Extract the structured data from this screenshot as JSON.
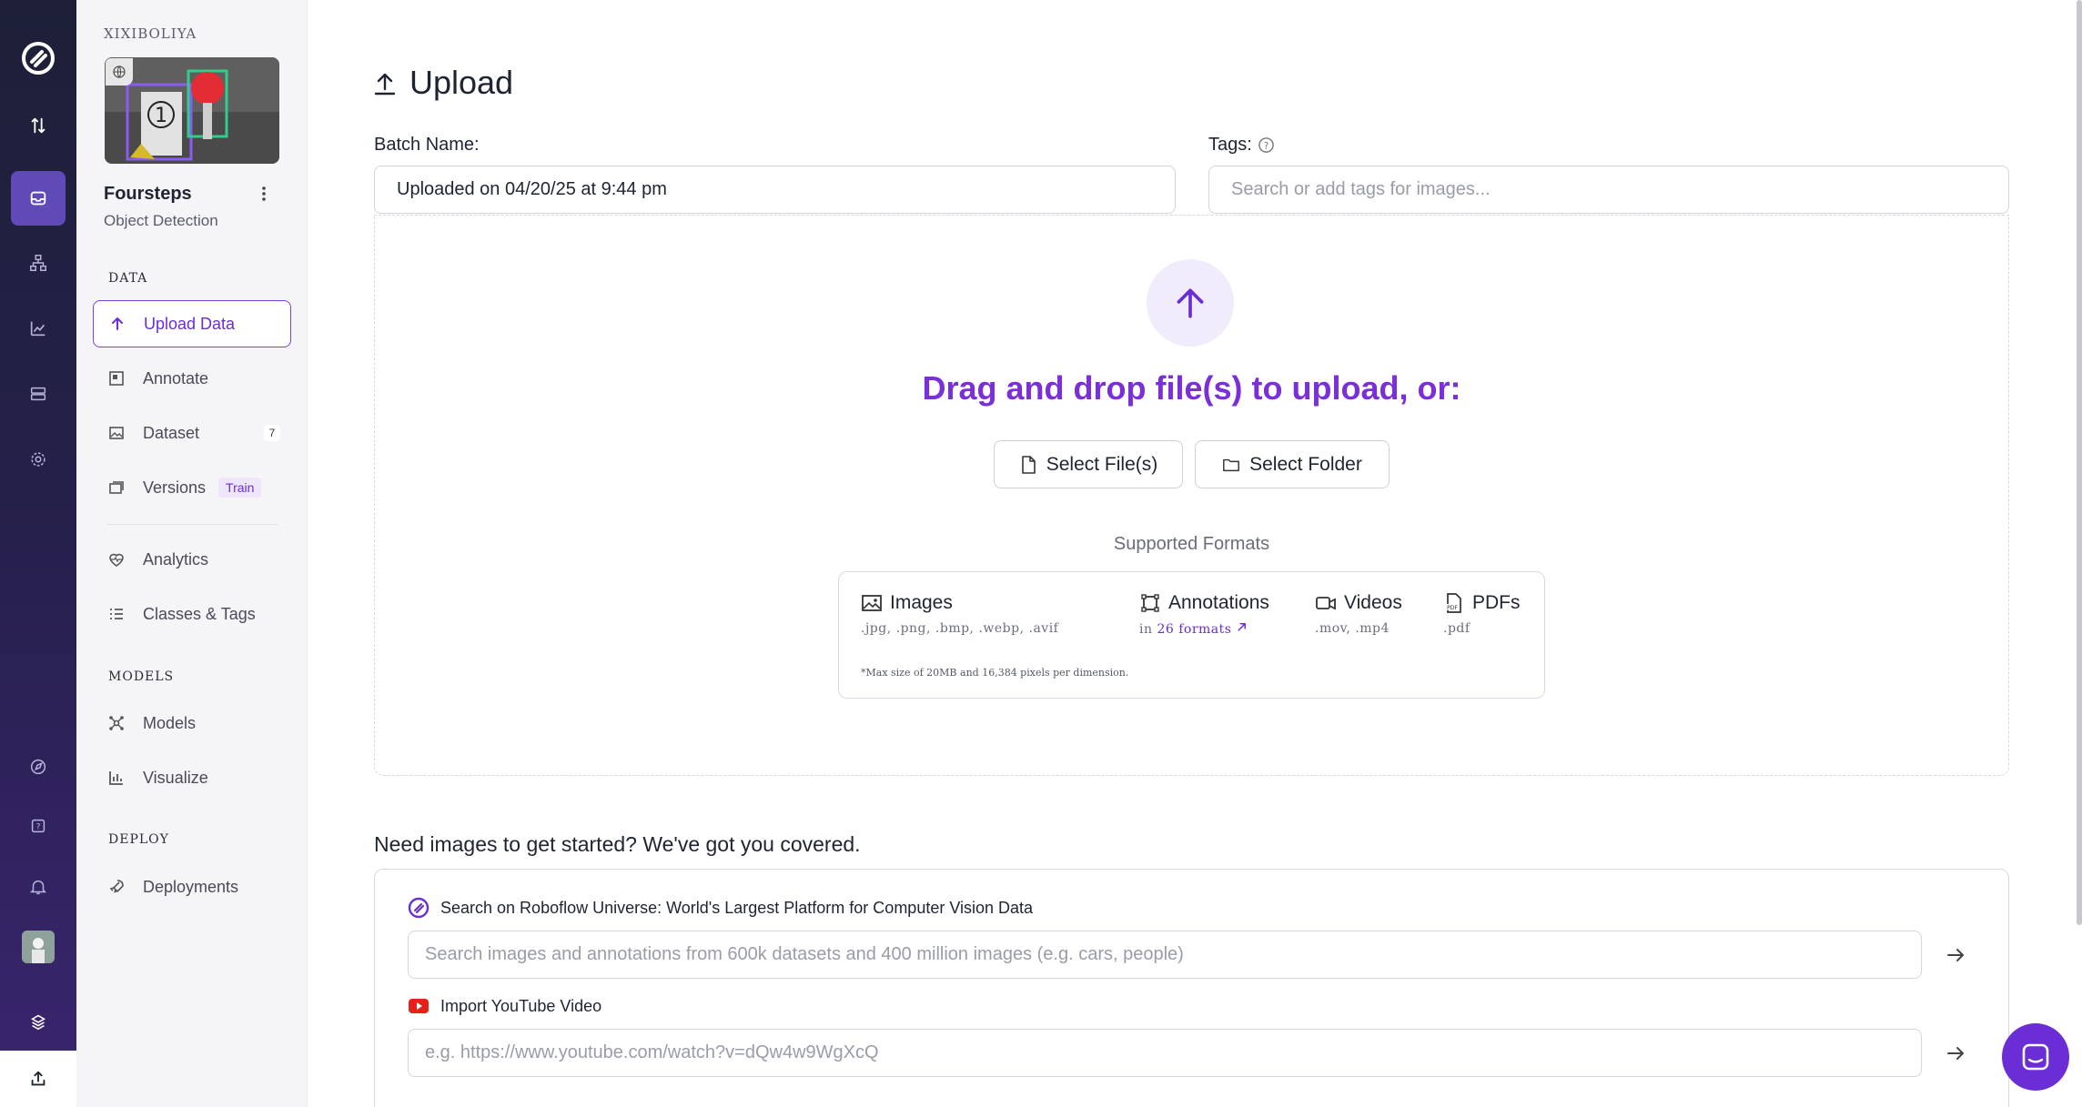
{
  "workspace": {
    "name": "XIXIBOLIYA"
  },
  "project": {
    "title": "Foursteps",
    "type": "Object Detection",
    "dataset_count": "7"
  },
  "sidebar": {
    "sections": {
      "data": "DATA",
      "models": "MODELS",
      "deploy": "DEPLOY"
    },
    "items": {
      "upload": "Upload Data",
      "annotate": "Annotate",
      "dataset": "Dataset",
      "versions": "Versions",
      "versions_badge": "Train",
      "analytics": "Analytics",
      "classes": "Classes & Tags",
      "models": "Models",
      "visualize": "Visualize",
      "deployments": "Deployments"
    }
  },
  "page": {
    "title": "Upload",
    "batch_label": "Batch Name:",
    "batch_value": "Uploaded on 04/20/25 at 9:44 pm",
    "tags_label": "Tags:",
    "tags_placeholder": "Search or add tags for images...",
    "drop_text": "Drag and drop file(s) to upload, or:",
    "select_files": "Select File(s)",
    "select_folder": "Select Folder",
    "supported_formats": "Supported Formats",
    "formats": {
      "images": {
        "title": "Images",
        "exts": ".jpg, .png, .bmp, .webp, .avif"
      },
      "annotations": {
        "title": "Annotations",
        "prefix": "in",
        "link": "26 formats"
      },
      "videos": {
        "title": "Videos",
        "exts": ".mov, .mp4"
      },
      "pdfs": {
        "title": "PDFs",
        "exts": ".pdf"
      },
      "note": "*Max size of 20MB and 16,384 pixels per dimension."
    },
    "need_images": "Need images to get started? We've got you covered.",
    "universe": {
      "title": "Search on Roboflow Universe: World's Largest Platform for Computer Vision Data",
      "placeholder": "Search images and annotations from 600k datasets and 400 million images (e.g. cars, people)"
    },
    "youtube": {
      "title": "Import YouTube Video",
      "placeholder": "e.g. https://www.youtube.com/watch?v=dQw4w9WgXcQ"
    }
  },
  "colors": {
    "accent": "#6a2dd6",
    "rail": "#1d2038"
  }
}
